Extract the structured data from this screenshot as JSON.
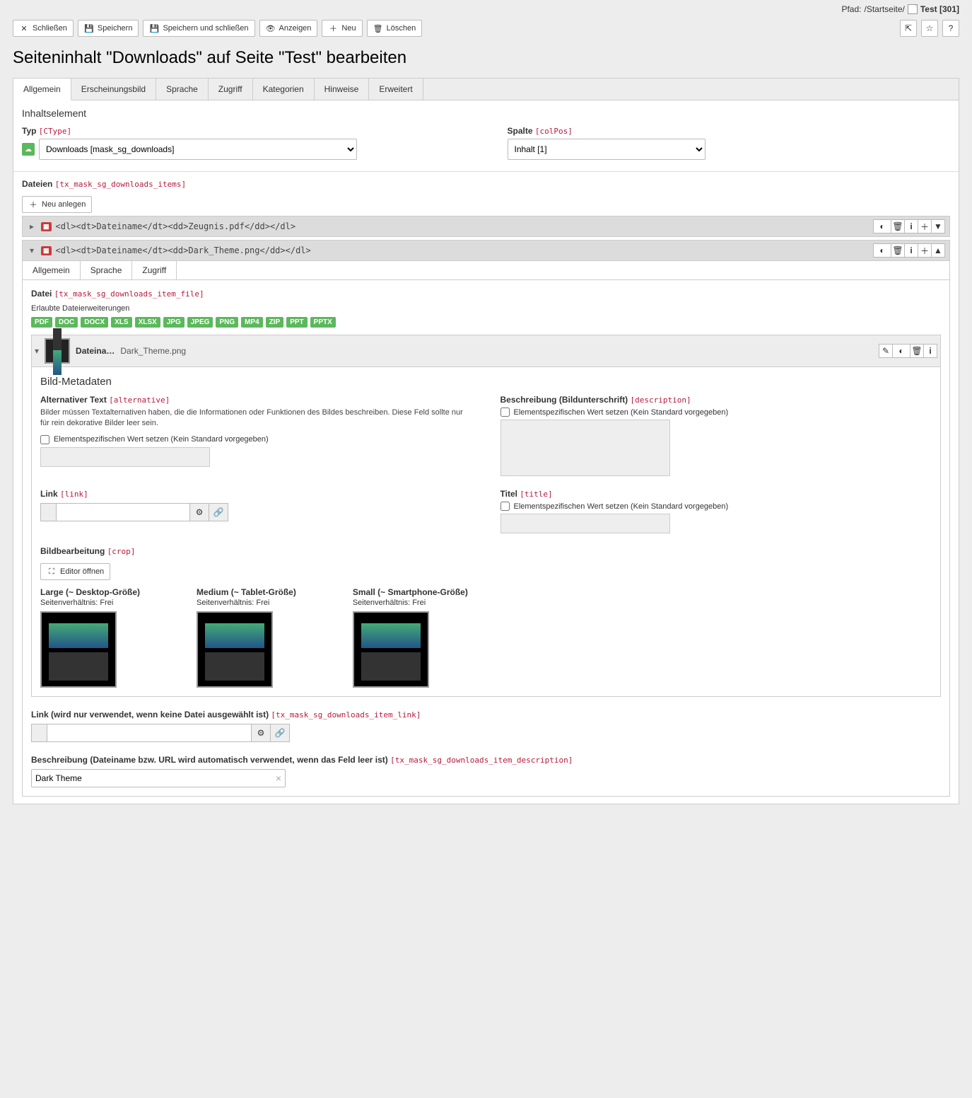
{
  "breadcrumb": {
    "path_label": "Pfad:",
    "root": "/Startseite/",
    "page": "Test [301]"
  },
  "toolbar": {
    "close": "Schließen",
    "save": "Speichern",
    "save_close": "Speichern und schließen",
    "view": "Anzeigen",
    "new": "Neu",
    "delete": "Löschen"
  },
  "page_title": "Seiteninhalt \"Downloads\" auf Seite \"Test\" bearbeiten",
  "tabs": [
    "Allgemein",
    "Erscheinungsbild",
    "Sprache",
    "Zugriff",
    "Kategorien",
    "Hinweise",
    "Erweitert"
  ],
  "section_heading": "Inhaltselement",
  "type_field": {
    "label": "Typ",
    "tech": "[CType]",
    "value": "Downloads [mask_sg_downloads]"
  },
  "column_field": {
    "label": "Spalte",
    "tech": "[colPos]",
    "value": "Inhalt [1]"
  },
  "files": {
    "label": "Dateien",
    "tech": "[tx_mask_sg_downloads_items]",
    "new_btn": "Neu anlegen",
    "items": [
      {
        "title": "<dl><dt>Dateiname</dt><dd>Zeugnis.pdf</dd></dl>"
      },
      {
        "title": "<dl><dt>Dateiname</dt><dd>Dark_Theme.png</dd></dl>"
      }
    ]
  },
  "item_tabs": [
    "Allgemein",
    "Sprache",
    "Zugriff"
  ],
  "item_file": {
    "label": "Datei",
    "tech": "[tx_mask_sg_downloads_item_file]",
    "allowed_label": "Erlaubte Dateierweiterungen",
    "extensions": [
      "PDF",
      "DOC",
      "DOCX",
      "XLS",
      "XLSX",
      "JPG",
      "JPEG",
      "PNG",
      "MP4",
      "ZIP",
      "PPT",
      "PPTX"
    ],
    "file_label": "Dateina…",
    "file_name": "Dark_Theme.png"
  },
  "metadata": {
    "heading": "Bild-Metadaten",
    "alt": {
      "label": "Alternativer Text",
      "tech": "[alternative]",
      "help": "Bilder müssen Textalternativen haben, die die Informationen oder Funktionen des Bildes beschreiben. Diese Feld sollte nur für rein dekorative Bilder leer sein.",
      "override": "Elementspezifischen Wert setzen (Kein Standard vorgegeben)"
    },
    "desc": {
      "label": "Beschreibung (Bildunterschrift)",
      "tech": "[description]",
      "override": "Elementspezifischen Wert setzen (Kein Standard vorgegeben)"
    },
    "link": {
      "label": "Link",
      "tech": "[link]"
    },
    "title": {
      "label": "Titel",
      "tech": "[title]",
      "override": "Elementspezifischen Wert setzen (Kein Standard vorgegeben)"
    },
    "crop": {
      "label": "Bildbearbeitung",
      "tech": "[crop]",
      "editor_btn": "Editor öffnen",
      "variants": [
        {
          "title": "Large (~ Desktop-Größe)",
          "ratio": "Seitenverhältnis: Frei"
        },
        {
          "title": "Medium (~ Tablet-Größe)",
          "ratio": "Seitenverhältnis: Frei"
        },
        {
          "title": "Small (~ Smartphone-Größe)",
          "ratio": "Seitenverhältnis: Frei"
        }
      ]
    }
  },
  "item_link": {
    "label": "Link (wird nur verwendet, wenn keine Datei ausgewählt ist)",
    "tech": "[tx_mask_sg_downloads_item_link]"
  },
  "item_desc": {
    "label": "Beschreibung (Dateiname bzw. URL wird automatisch verwendet, wenn das Feld leer ist)",
    "tech": "[tx_mask_sg_downloads_item_description]",
    "value": "Dark Theme"
  }
}
